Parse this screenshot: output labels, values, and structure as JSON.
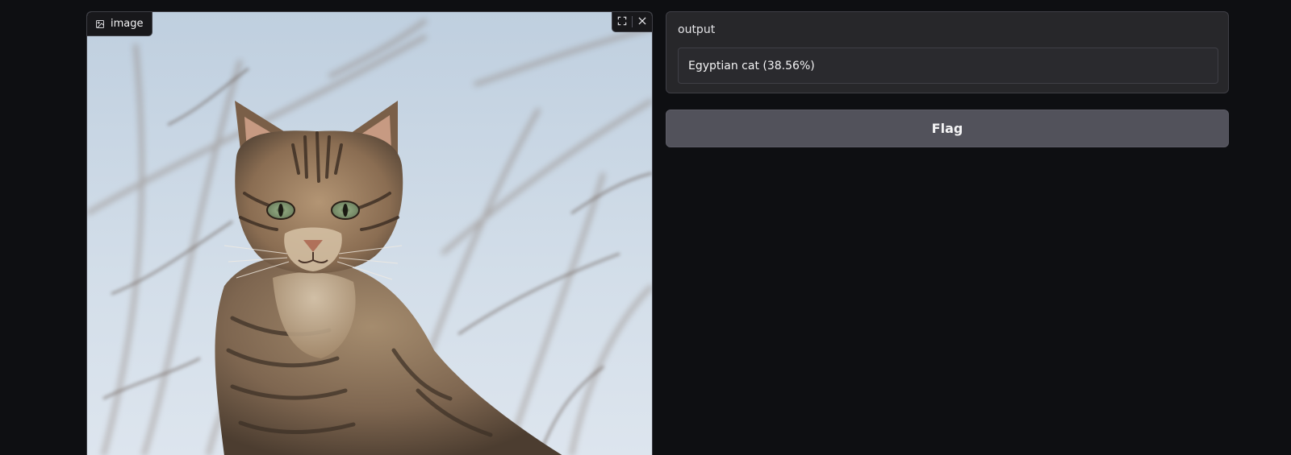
{
  "image_input": {
    "label": "image",
    "label_icon": "image-icon",
    "tools": {
      "fullscreen_icon": "fullscreen-icon",
      "clear_icon": "close-icon"
    },
    "photo_subject": "tabby-cat-photo"
  },
  "output": {
    "label": "output",
    "value": "Egyptian cat (38.56%)"
  },
  "flag": {
    "label": "Flag"
  },
  "colors": {
    "background": "#0e0f12",
    "panel": "#27272a",
    "button": "#52525b"
  }
}
